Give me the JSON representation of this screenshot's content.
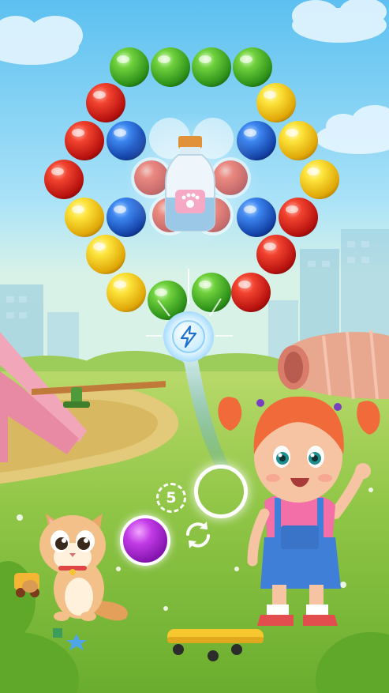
{
  "hud": {
    "shots_left": "5"
  },
  "icons": {
    "swap": "swap-arrows-icon",
    "booster": "lightning-icon",
    "target": "milk-bottle-paw-icon"
  },
  "colors": {
    "sky_top": "#6fc8f2",
    "grass": "#8cc63f",
    "ball_red": "#e52a22",
    "ball_yellow": "#f5d21a",
    "ball_blue": "#1f63d8",
    "ball_green": "#4fb72b",
    "ball_purple": "#b02fe0"
  }
}
